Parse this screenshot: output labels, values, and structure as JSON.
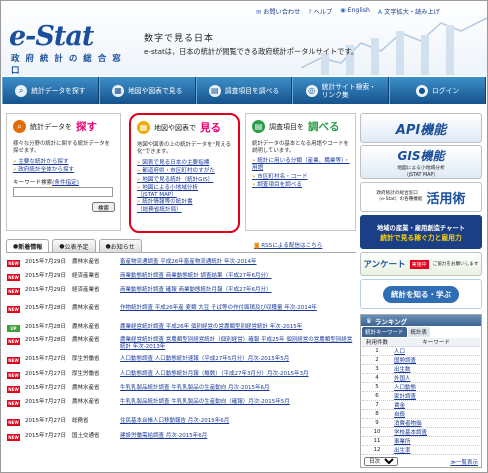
{
  "header": {
    "logo": "e-Stat",
    "logo_small": "statistics",
    "subtitle": "政 府 統 計 の 総 合 窓 口",
    "catch1": "数字で見る日本",
    "catch2": "e-statは，日本の統計が閲覧できる政府統計ポータルサイトです。",
    "links": [
      "お問い合わせ",
      "ヘルプ",
      "English",
      "文字拡大・読み上げ"
    ]
  },
  "nav": [
    {
      "label": "統計データを探す",
      "icon": "magnifier-icon"
    },
    {
      "label": "地図や図表で見る",
      "icon": "map-icon"
    },
    {
      "label": "調査項目を調べる",
      "icon": "document-icon"
    },
    {
      "label": "統計サイト検索・\nリンク集",
      "icon": "globe-icon"
    },
    {
      "label": "ログイン",
      "icon": "person-icon"
    }
  ],
  "box1": {
    "title_small": "統計データを",
    "title_big": "探す",
    "desc": "様々な分野の統計に関する統計データを探せます。",
    "links": [
      "主要な統計から探す",
      "政府統計全体から探す"
    ],
    "keyword_label": "キーワード検索",
    "keyword_help": "(条件指定)",
    "search_button": "検索"
  },
  "box2": {
    "title_small": "地図や図表で",
    "title_big": "見る",
    "desc": "地図や図表の上の統計データを\"見える化\"できます。",
    "links": [
      "図表で見る日本の主要指標",
      "都道府県・市区町村のすがた",
      "地図で見る統計（統計GIS）",
      "地図による小地域分析\n（jSTAT MAP）",
      "統計情報等の統計書\n（総務省統計局）"
    ]
  },
  "box3": {
    "title_small": "調査項目を",
    "title_big": "調べる",
    "desc": "統計データの基本となる用語やコードを説明しています。",
    "links": [
      "統計に用いる分類（産業、職業等）・用語",
      "市区町村名・コード",
      "調査項目を調べる"
    ]
  },
  "sidebar": {
    "api": "API機能",
    "gis_title": "GIS機能",
    "gis_sub": "地図による小地域分析\n（jSTAT MAP）",
    "katsuyou_small": "政府統計の総合窓口\n（e-Stat）の各種機能",
    "katsuyou": "活用術",
    "region1": "地域の産業・雇用創造チャート",
    "region2": "統計で見る稼ぐ力と雇用力",
    "enquete": "アンケート",
    "enquete_badge": "実施中",
    "enquete_sub": "ご協力をお願いします",
    "shiru": "統計を知る・学ぶ"
  },
  "tabs": [
    "新着情報",
    "公表予定",
    "お知らせ"
  ],
  "rss": "RSSによる配信はこちら",
  "news": [
    {
      "badge": "NEW",
      "date": "2015年7月29日",
      "agency": "農林水産省",
      "title": "畜産物流通調査 平成26年畜産物流通統計 年次-2014年"
    },
    {
      "badge": "NEW",
      "date": "2015年7月29日",
      "agency": "経済産業省",
      "title": "商業動態統計調査 商業動態統計 調査結果（平成27年6月分）"
    },
    {
      "badge": "NEW",
      "date": "2015年7月29日",
      "agency": "経済産業省",
      "title": "商業動態統計調査 確報 商業動態統計月報（平成27年6月分）"
    },
    {
      "badge": "NEW",
      "date": "2015年7月28日",
      "agency": "農林水産省",
      "title": "作物統計調査 平成26年産 麦類 大豆 そば等の作付面積及び収穫量 年次-2014年"
    },
    {
      "badge": "UP",
      "date": "2015年7月28日",
      "agency": "農林水産省",
      "title": "農業経営統計調査 平成26年 個別経営の営農類型別経営統計 年次-2015年"
    },
    {
      "badge": "NEW",
      "date": "2015年7月28日",
      "agency": "農林水産省",
      "title": "農業経営統計調査 営農類型別経営統計（個別経営）確報 平成25年 個別経営の営農類型別経営統計 年次-2013年"
    },
    {
      "badge": "NEW",
      "date": "2015年7月27日",
      "agency": "厚生労働省",
      "title": "人口動態調査 人口動態統計速報（平成27年5月分）月次-2015年5月"
    },
    {
      "badge": "NEW",
      "date": "2015年7月27日",
      "agency": "厚生労働省",
      "title": "人口動態調査 人口動態統計月報（概数）（平成27年3月分）月次-2015年3月"
    },
    {
      "badge": "NEW",
      "date": "2015年7月27日",
      "agency": "農林水産省",
      "title": "牛乳乳製品統計調査 牛乳乳製品の生産動向 月次-2015年6月"
    },
    {
      "badge": "NEW",
      "date": "2015年7月27日",
      "agency": "農林水産省",
      "title": "牛乳乳製品統計調査 牛乳乳製品の生産動向（確報）月次-2015年5月"
    },
    {
      "badge": "NEW",
      "date": "2015年7月27日",
      "agency": "総務省",
      "title": "住民基本台帳人口移動報告 月次-2015年6月"
    },
    {
      "badge": "NEW",
      "date": "2015年7月27日",
      "agency": "国土交通省",
      "title": "建設労働需給調査 月次-2015年6月"
    }
  ],
  "ranking": {
    "title": "ランキング",
    "tab1": "統計キーワード",
    "tab2": "統計表",
    "col_rank": "利用件数",
    "col_kw": "キーワード",
    "rows": [
      [
        "1",
        "人口"
      ],
      [
        "2",
        "国勢調査"
      ],
      [
        "3",
        "出生数"
      ],
      [
        "4",
        "外国人"
      ],
      [
        "5",
        "人口動態"
      ],
      [
        "6",
        "家計調査"
      ],
      [
        "7",
        "賃金"
      ],
      [
        "8",
        "自殺"
      ],
      [
        "9",
        "消費者物価"
      ],
      [
        "10",
        "学校基本調査"
      ],
      [
        "11",
        "事業所"
      ],
      [
        "12",
        "出生率"
      ]
    ],
    "select_value": "日次",
    "more": "一覧表示"
  }
}
